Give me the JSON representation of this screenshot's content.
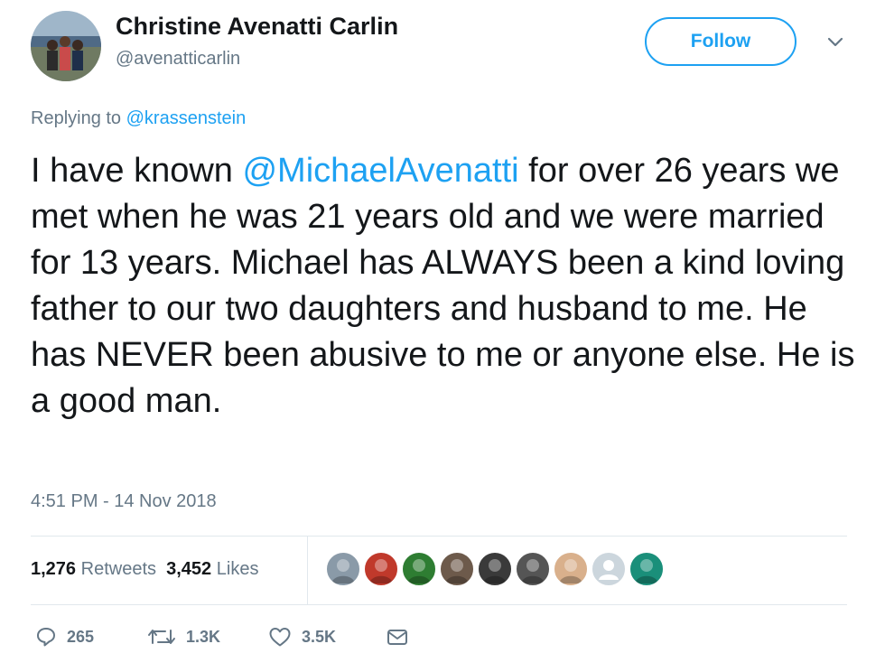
{
  "author": {
    "name": "Christine Avenatti Carlin",
    "handle": "@avenatticarlin"
  },
  "follow_label": "Follow",
  "reply": {
    "prefix": "Replying to ",
    "mention": "@krassenstein"
  },
  "text": {
    "pre": "I have known ",
    "mention": "@MichaelAvenatti",
    "post": " for over 26 years we met when he was 21 years old and we were married for 13 years. Michael has ALWAYS been a kind loving father to our two daughters and husband to me. He has NEVER been abusive to me or anyone else. He is a good man."
  },
  "timestamp": "4:51 PM - 14 Nov 2018",
  "stats": {
    "retweets_count": "1,276",
    "retweets_label": "Retweets",
    "likes_count": "3,452",
    "likes_label": "Likes"
  },
  "likers": [
    {
      "icon": "liker-avatar",
      "color": "#8a9aa8"
    },
    {
      "icon": "liker-avatar",
      "color": "#c0392b"
    },
    {
      "icon": "liker-avatar",
      "color": "#2e7d32"
    },
    {
      "icon": "liker-avatar",
      "color": "#6d5a4b"
    },
    {
      "icon": "liker-avatar",
      "color": "#3a3a3a"
    },
    {
      "icon": "liker-avatar",
      "color": "#555555"
    },
    {
      "icon": "liker-avatar",
      "color": "#d9b08c"
    },
    {
      "icon": "default-avatar",
      "color": "#ccd6dd"
    },
    {
      "icon": "liker-avatar",
      "color": "#1a8f7a"
    }
  ],
  "actions": {
    "replies": "265",
    "retweets": "1.3K",
    "likes": "3.5K"
  },
  "colors": {
    "accent": "#1da1f2",
    "secondary_text": "#657786",
    "primary_text": "#14171a"
  }
}
